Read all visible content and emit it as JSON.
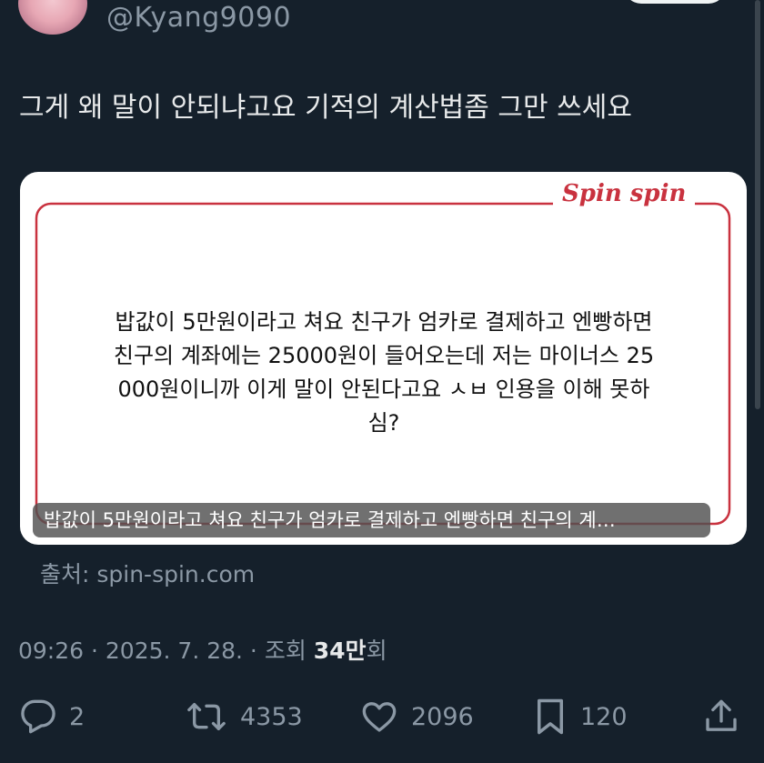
{
  "header": {
    "handle": "@Kyang9090"
  },
  "tweet": {
    "text": "그게 왜 말이 안되냐고요 기적의 계산법좀 그만 쓰세요"
  },
  "card": {
    "brand": "Spin spin",
    "lines": [
      "밥값이 5만원이라고 쳐요 친구가 엄카로 결제하고 엔빵하면",
      "친구의 계좌에는 25000원이 들어오는데 저는 마이너스 25",
      "000원이니까 이게 말이 안된다고요 ㅅㅂ 인용을 이해 못하",
      "심?"
    ],
    "caption": "밥값이 5만원이라고 쳐요 친구가 엄카로 결제하고 엔빵하면 친구의 계…",
    "accent_color": "#c9323f"
  },
  "source": "출처: spin-spin.com",
  "meta": {
    "time": "09:26",
    "sep1": " · ",
    "date": "2025. 7. 28.",
    "sep2": " · ",
    "views_label": "조회 ",
    "views_count": "34만",
    "views_suffix": "회"
  },
  "actions": {
    "reply_count": "2",
    "retweet_count": "4353",
    "like_count": "2096",
    "bookmark_count": "120"
  },
  "icons": [
    "reply-icon",
    "retweet-icon",
    "like-icon",
    "bookmark-icon",
    "share-icon"
  ]
}
